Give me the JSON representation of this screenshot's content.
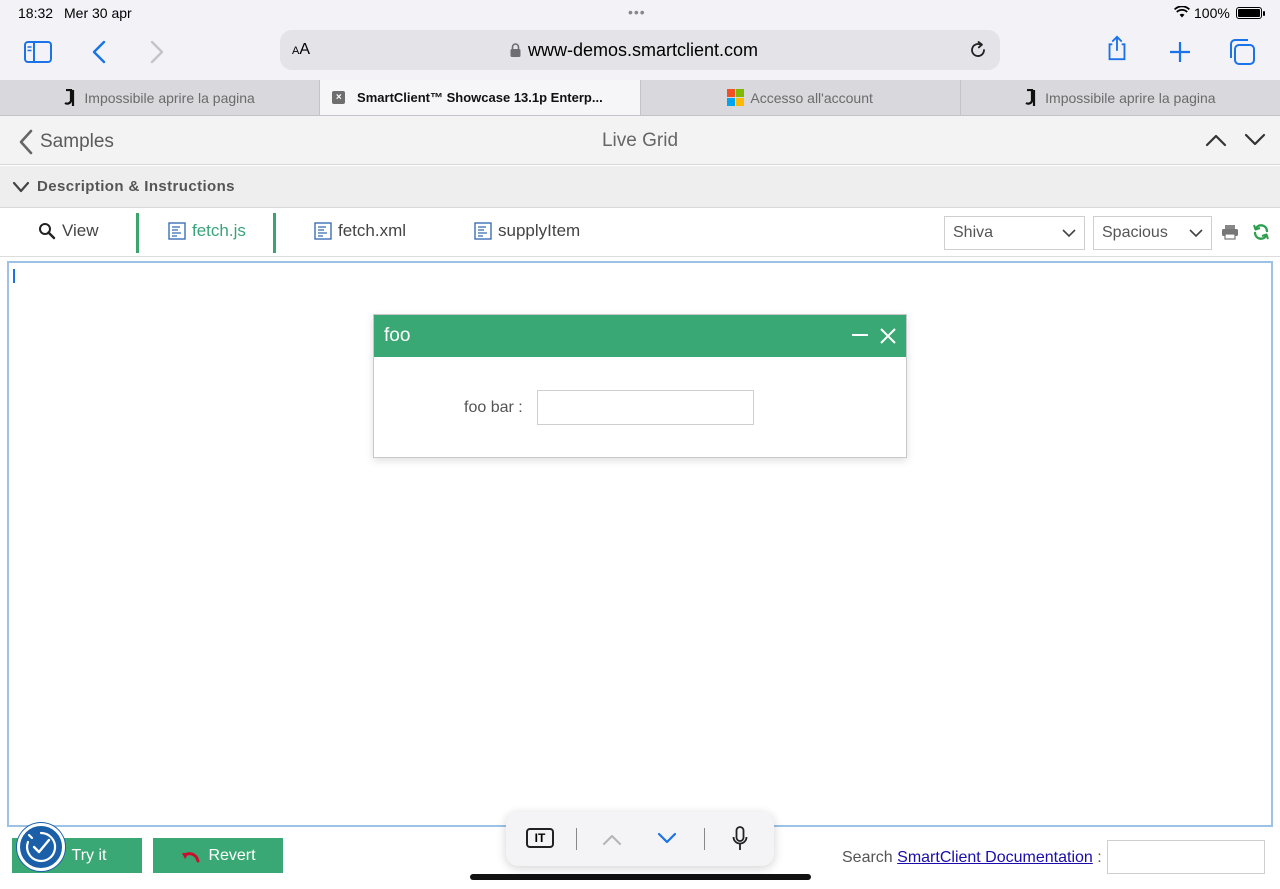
{
  "status_bar": {
    "time": "18:32",
    "date": "Mer 30 apr",
    "battery": "100%"
  },
  "browser": {
    "text_size_label": "AA",
    "url": "www-demos.smartclient.com",
    "tabs": [
      {
        "label": "Impossibile aprire la pagina",
        "icon": "juventus-logo-icon",
        "active": false
      },
      {
        "label": "SmartClient™ Showcase 13.1p Enterp...",
        "icon": "close-icon",
        "active": true
      },
      {
        "label": "Accesso all'account",
        "icon": "microsoft-logo-icon",
        "active": false
      },
      {
        "label": "Impossibile aprire la pagina",
        "icon": "juventus-logo-icon",
        "active": false
      }
    ]
  },
  "nav": {
    "back_label": "Samples",
    "title": "Live Grid"
  },
  "description": {
    "label": "Description & Instructions"
  },
  "source_tabs": [
    {
      "label": "View",
      "icon": "search-icon"
    },
    {
      "label": "fetch.js",
      "icon": "file-icon",
      "active": true
    },
    {
      "label": "fetch.xml",
      "icon": "file-icon"
    },
    {
      "label": "supplyItem",
      "icon": "file-icon"
    }
  ],
  "skin_select": {
    "value": "Shiva"
  },
  "density_select": {
    "value": "Spacious"
  },
  "dialog": {
    "title": "foo",
    "field_label": "foo bar :",
    "field_value": ""
  },
  "bottom": {
    "try_label": "Try it",
    "revert_label": "Revert",
    "search_prefix": "Search",
    "search_link": "SmartClient Documentation",
    "search_suffix": " :"
  },
  "keyboard_bar": {
    "lang": "IT"
  },
  "colors": {
    "accent": "#3aa874",
    "link": "#1a0dab",
    "editor_border": "#9cc3e6"
  }
}
